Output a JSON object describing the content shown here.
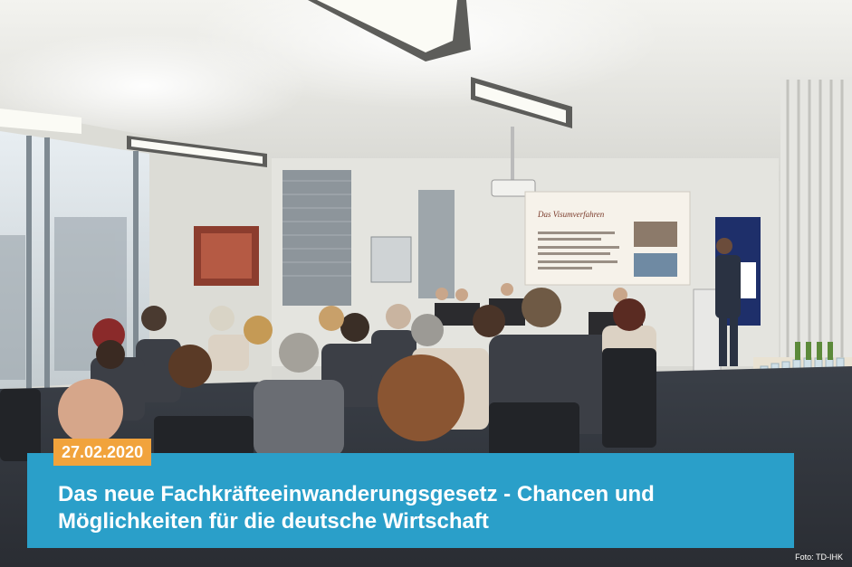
{
  "photo": {
    "description_icon": "seminar-room-photo",
    "slide_title": "Das Visumverfahren"
  },
  "overlay": {
    "date": "27.02.2020",
    "title": "Das neue Fachkräfteeinwanderungsgesetz - Chancen und Möglichkeiten für die deutsche Wirtschaft",
    "credit": "Foto: TD-IHK"
  },
  "colors": {
    "caption_bg": "#2a9fc9",
    "date_bg": "#f1a33c"
  }
}
